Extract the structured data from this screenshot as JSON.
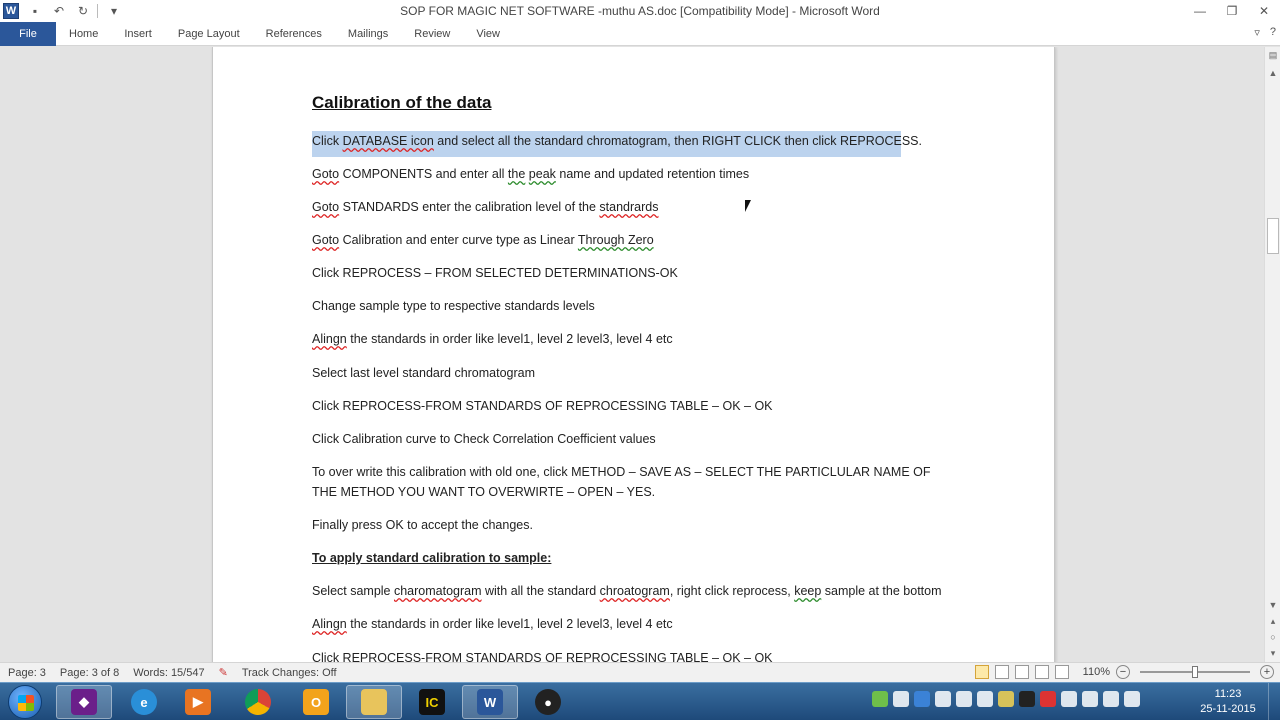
{
  "window": {
    "title": "SOP FOR MAGIC NET SOFTWARE -muthu AS.doc [Compatibility Mode]  -  Microsoft Word",
    "app_icon_letter": "W"
  },
  "ribbon": {
    "file_label": "File",
    "tabs": [
      "Home",
      "Insert",
      "Page Layout",
      "References",
      "Mailings",
      "Review",
      "View"
    ]
  },
  "document": {
    "heading": "Calibration of the data",
    "line1_pre": "Click ",
    "line1_link": "DATABASE  icon",
    "line1_post": "  and select all the standard chromatogram, then RIGHT CLICK then click REPROCESS.",
    "line2_goto": "Goto",
    "line2_mid": " COMPONENTS and enter all ",
    "line2_the": "the",
    "line2_sp": "  ",
    "line2_peak": "peak",
    "line2_post": " name and updated retention times",
    "line3_goto": "Goto",
    "line3_mid": " STANDARDS enter the calibration level of the ",
    "line3_err": "standrards",
    "line4_goto": "Goto",
    "line4_mid": " Calibration and enter curve type as Linear ",
    "line4_err": "Through  Zero",
    "line5": "Click REPROCESS – FROM SELECTED DETERMINATIONS-OK",
    "line6": "Change sample type to respective standards levels",
    "line7_err": "Alingn",
    "line7_post": " the standards in order like level1, level 2 level3, level 4   etc",
    "line8": "Select last level standard chromatogram",
    "line9": "Click REPROCESS-FROM STANDARDS OF REPROCESSING TABLE – OK – OK",
    "line10": "Click Calibration curve to Check Correlation Coefficient values",
    "line11": "To over write this calibration with old one, click  METHOD – SAVE AS – SELECT THE PARTICLULAR NAME OF THE METHOD YOU WANT TO OVERWIRTE – OPEN – YES.",
    "line12": "Finally press OK to accept the changes.",
    "subheading": "To apply standard calibration to sample:",
    "line13_pre": "Select sample ",
    "line13_err1": "charomatogram",
    "line13_mid": " with all the standard ",
    "line13_err2": "chroatogram",
    "line13_mid2": ", right click reprocess, ",
    "line13_err3": "keep",
    "line13_post": " sample at the bottom",
    "line14_err": "Alingn",
    "line14_post": " the standards in order like level1, level 2 level3, level 4   etc",
    "line15": "Click REPROCESS-FROM STANDARDS OF REPROCESSING TABLE – OK – OK"
  },
  "statusbar": {
    "page": "Page: 3",
    "page_of": "Page: 3 of 8",
    "words": "Words: 15/547",
    "track_changes": "Track Changes: Off",
    "zoom": "110%",
    "zoom_level": 0.5
  },
  "taskbar": {
    "time": "11:23",
    "date": "25-11-2015",
    "apps": [
      "shield-app",
      "internet-explorer",
      "media-player",
      "chrome",
      "outlook",
      "file-explorer",
      "ic-app",
      "word",
      "obs"
    ]
  },
  "colors": {
    "word_blue": "#2b579a",
    "selection": "#bcd3ee",
    "taskbar": "#1e4a7a"
  }
}
